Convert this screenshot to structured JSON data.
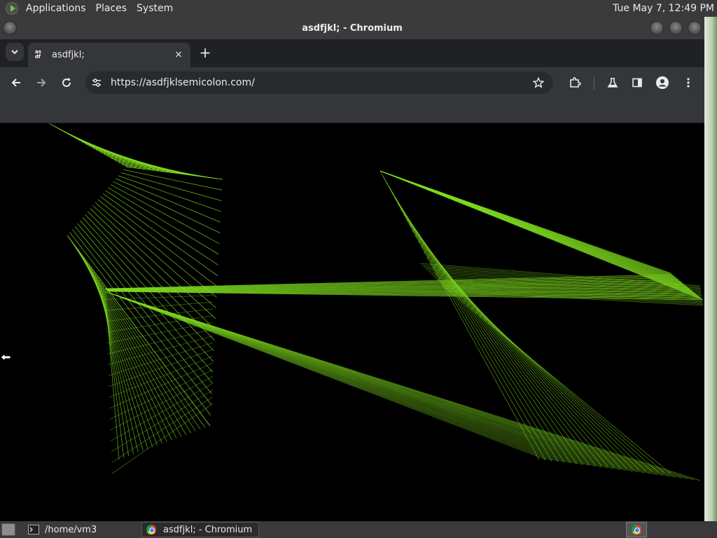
{
  "top_panel": {
    "menus": [
      "Applications",
      "Places",
      "System"
    ],
    "clock": "Tue May 7, 12:49 PM"
  },
  "window": {
    "title": "asdfjkl; - Chromium"
  },
  "browser": {
    "tab": {
      "title": "asdfjkl;",
      "favicon_text": "as df",
      "close_icon": "×"
    },
    "new_tab_icon": "+",
    "url": "https://asdfjklsemicolon.com/",
    "icons": {
      "back": "arrow-left-icon",
      "forward": "arrow-right-icon",
      "reload": "reload-icon",
      "site_info": "tune-icon",
      "bookmark": "star-icon",
      "extensions": "puzzle-icon",
      "labs": "flask-icon",
      "side_panel": "side-panel-icon",
      "profile": "profile-icon",
      "menu": "kebab-menu-icon"
    }
  },
  "page": {
    "background": "#000000",
    "line_color": "#7fdc1e"
  },
  "taskbar": {
    "tasks": [
      {
        "label": "/home/vm3",
        "icon": "terminal-icon"
      },
      {
        "label": "asdfjkl; - Chromium",
        "icon": "chromium-icon"
      }
    ]
  }
}
